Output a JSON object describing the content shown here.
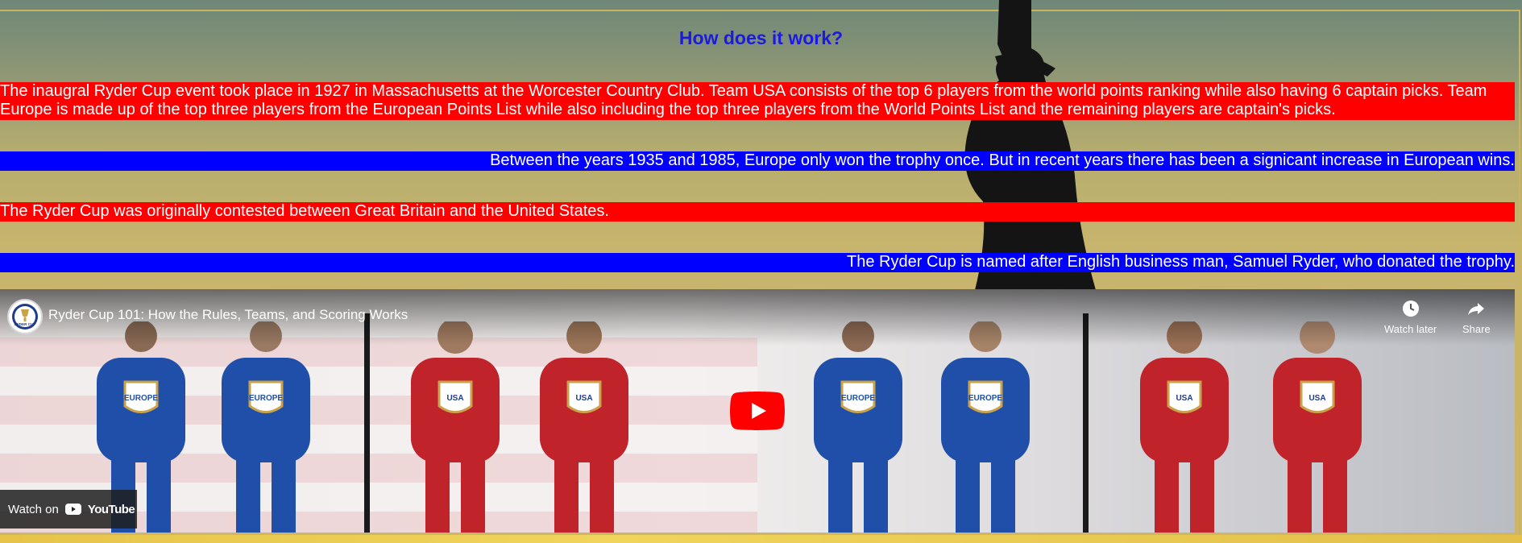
{
  "section": {
    "title": "How does it work?"
  },
  "facts": [
    {
      "text": "The inaugral Ryder Cup event took place in 1927 in Massachusetts at the Worcester Country Club. Team USA consists of the top 6 players from the world points ranking while also having 6 captain picks. Team Europe is made up of the top three players from the European Points List while also including the top three players from the World Points List and the remaining players are captain's picks.",
      "color": "#ff0000"
    },
    {
      "text": "Between the years 1935 and 1985, Europe only won the trophy once. But in recent years there has been a signicant increase in European wins.",
      "color": "#0000ff"
    },
    {
      "text": "The Ryder Cup was originally contested between Great Britain and the United States.",
      "color": "#ff0000"
    },
    {
      "text": "The Ryder Cup is named after English business man, Samuel Ryder, who donated the trophy.",
      "color": "#0000ff"
    }
  ],
  "video": {
    "title": "Ryder Cup 101: How the Rules, Teams, and Scoring Works",
    "watch_later_label": "Watch later",
    "share_label": "Share",
    "watch_on_label": "Watch on",
    "youtube_label": "YouTube",
    "channel_logo_text": "RYDER CUP",
    "team_labels": [
      "EUROPE",
      "EUROPE",
      "USA",
      "USA",
      "EUROPE",
      "EUROPE",
      "USA",
      "USA"
    ],
    "team_colors": {
      "europe": "#1f4fa8",
      "usa": "#c1232b"
    },
    "icons": [
      "clock-icon",
      "share-arrow-icon",
      "youtube-play-icon",
      "youtube-logo-icon"
    ]
  }
}
